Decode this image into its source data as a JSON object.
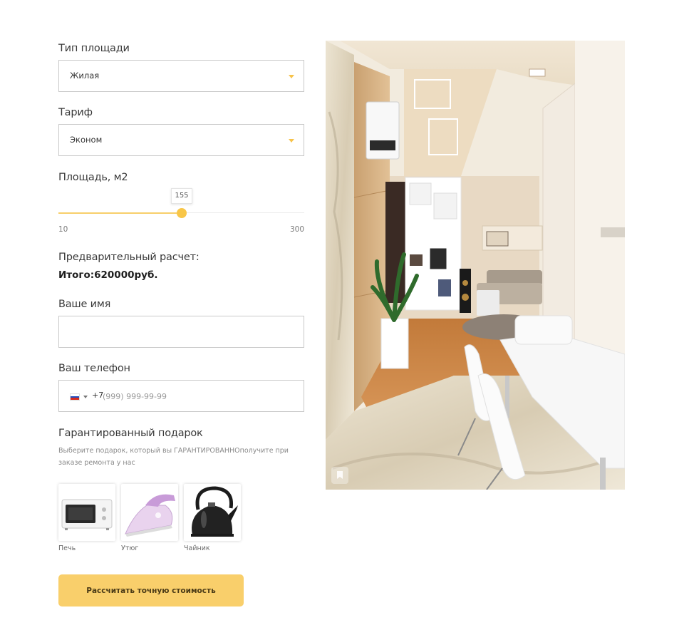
{
  "area_type": {
    "label": "Тип площади",
    "value": "Жилая"
  },
  "tariff": {
    "label": "Тариф",
    "value": "Эконом"
  },
  "area": {
    "label": "Площадь, м2",
    "value": "155",
    "min": "10",
    "max": "300",
    "fraction": 0.5
  },
  "estimate": {
    "label": "Предварительный расчет:",
    "total": "Итого:620000руб."
  },
  "name_field": {
    "label": "Ваше имя",
    "placeholder": ""
  },
  "phone_field": {
    "label": "Ваш телефон",
    "prefix": "+7",
    "placeholder": "(999) 999-99-99",
    "country_flag": "ru-flag-icon"
  },
  "gift": {
    "title": "Гарантированный подарок",
    "description": "Выберите подарок, который вы ГАРАНТИРОВАННОполучите при заказе ремонта у нас",
    "options": [
      {
        "label": "Печь",
        "icon": "microwave-oven-icon"
      },
      {
        "label": "Утюг",
        "icon": "iron-icon"
      },
      {
        "label": "Чайник",
        "icon": "kettle-icon"
      }
    ]
  },
  "submit_label": "Рассчитать точную стоимость",
  "colors": {
    "accent": "#f8c648",
    "button": "#f9cf6b",
    "border": "#c9c9c9"
  }
}
